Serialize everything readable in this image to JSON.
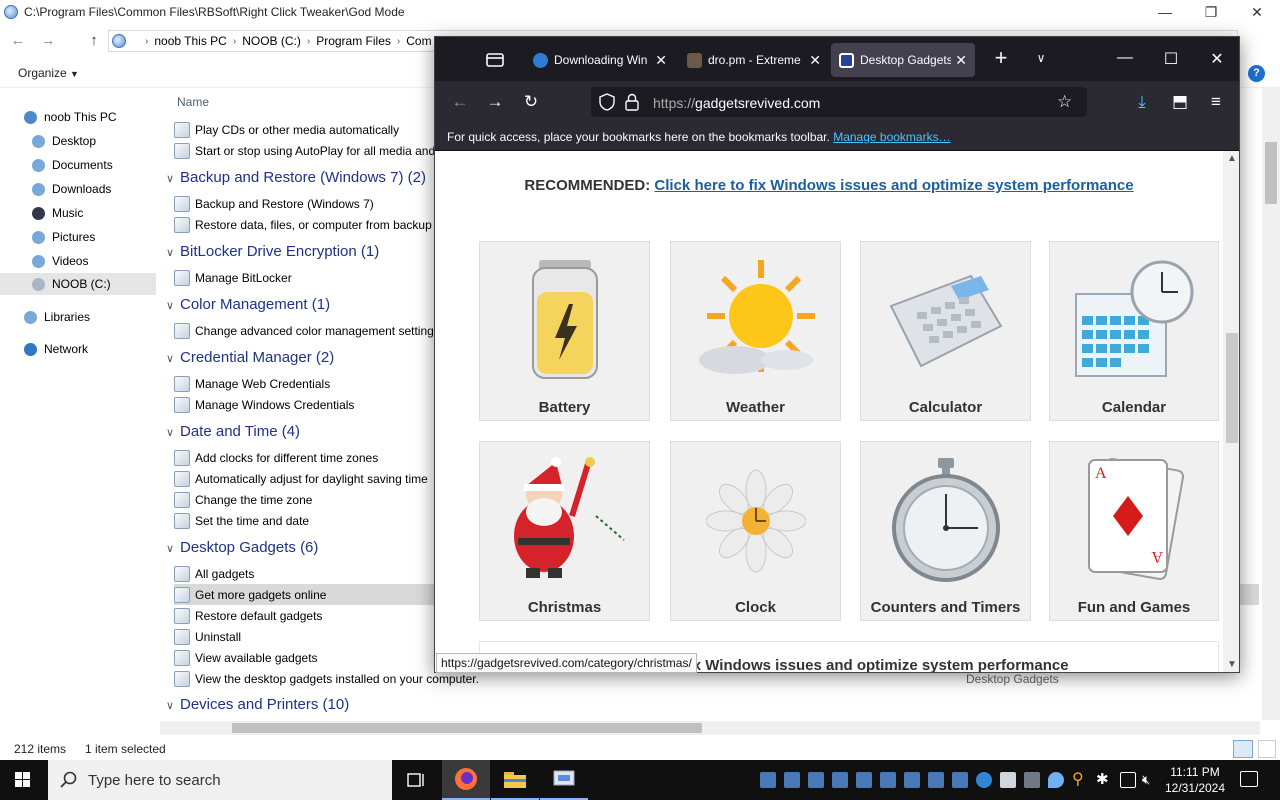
{
  "explorer": {
    "title_path": "C:\\Program Files\\Common Files\\RBSoft\\Right Click Tweaker\\God Mode",
    "breadcrumbs": [
      "noob This PC",
      "NOOB (C:)",
      "Program Files",
      "Com"
    ],
    "organize_label": "Organize",
    "help_label": "?",
    "column_name": "Name",
    "nav_items": [
      {
        "label": "noob This PC",
        "icon": "pc-icon"
      },
      {
        "label": "Desktop",
        "icon": "desktop-icon"
      },
      {
        "label": "Documents",
        "icon": "documents-icon"
      },
      {
        "label": "Downloads",
        "icon": "downloads-icon"
      },
      {
        "label": "Music",
        "icon": "music-icon"
      },
      {
        "label": "Pictures",
        "icon": "pictures-icon"
      },
      {
        "label": "Videos",
        "icon": "videos-icon"
      },
      {
        "label": "NOOB (C:)",
        "icon": "drive-icon"
      },
      {
        "label": "Libraries",
        "icon": "libraries-icon"
      },
      {
        "label": "Network",
        "icon": "network-icon"
      }
    ],
    "rows": [
      {
        "type": "item",
        "label": "Play CDs or other media automatically"
      },
      {
        "type": "item",
        "label": "Start or stop using AutoPlay for all media and"
      },
      {
        "type": "group",
        "label": "Backup and Restore (Windows 7) (2)"
      },
      {
        "type": "item",
        "label": "Backup and Restore (Windows 7)"
      },
      {
        "type": "item",
        "label": "Restore data, files, or computer from backup"
      },
      {
        "type": "group",
        "label": "BitLocker Drive Encryption (1)"
      },
      {
        "type": "item",
        "label": "Manage BitLocker"
      },
      {
        "type": "group",
        "label": "Color Management (1)"
      },
      {
        "type": "item",
        "label": "Change advanced color management setting"
      },
      {
        "type": "group",
        "label": "Credential Manager (2)"
      },
      {
        "type": "item",
        "label": "Manage Web Credentials"
      },
      {
        "type": "item",
        "label": "Manage Windows Credentials"
      },
      {
        "type": "group",
        "label": "Date and Time (4)"
      },
      {
        "type": "item",
        "label": "Add clocks for different time zones"
      },
      {
        "type": "item",
        "label": "Automatically adjust for daylight saving time"
      },
      {
        "type": "item",
        "label": "Change the time zone"
      },
      {
        "type": "item",
        "label": "Set the time and date"
      },
      {
        "type": "group",
        "label": "Desktop Gadgets (6)"
      },
      {
        "type": "item",
        "label": "All gadgets"
      },
      {
        "type": "item",
        "label": "Get more gadgets online",
        "selected": true
      },
      {
        "type": "item",
        "label": "Restore default gadgets"
      },
      {
        "type": "item",
        "label": "Uninstall"
      },
      {
        "type": "item",
        "label": "View available gadgets"
      },
      {
        "type": "item",
        "label": "View the desktop gadgets installed on your computer."
      },
      {
        "type": "group",
        "label": "Devices and Printers (10)"
      }
    ],
    "item_category_caption": "Desktop Gadgets",
    "status_count": "212 items",
    "status_selected": "1 item selected"
  },
  "firefox": {
    "tabs": [
      {
        "label": "Downloading Win",
        "active": false,
        "favicon_color": "#2f7bd6"
      },
      {
        "label": "dro.pm - Extreme",
        "active": false,
        "favicon_color": "#6b5a48"
      },
      {
        "label": "Desktop Gadgets",
        "active": true,
        "favicon_color": "#2b3fa0"
      }
    ],
    "url_protocol": "https://",
    "url_host": "gadgetsrevived.com",
    "bookmarks_hint": "For quick access, place your bookmarks here on the bookmarks toolbar.",
    "bookmarks_link": "Manage bookmarks…",
    "recommended_label": "RECOMMENDED:",
    "recommended_link": "Click here to fix Windows issues and optimize system performance",
    "recommended_link_partial": "here to fix Windows issues and optimize system performance",
    "gadgets": [
      {
        "name": "Battery",
        "icon": "battery-icon"
      },
      {
        "name": "Weather",
        "icon": "weather-icon"
      },
      {
        "name": "Calculator",
        "icon": "calculator-icon"
      },
      {
        "name": "Calendar",
        "icon": "calendar-icon"
      },
      {
        "name": "Christmas",
        "icon": "santa-icon"
      },
      {
        "name": "Clock",
        "icon": "clock-icon"
      },
      {
        "name": "Counters and Timers",
        "icon": "stopwatch-icon"
      },
      {
        "name": "Fun and Games",
        "icon": "playing-card-icon"
      }
    ],
    "status_url": "https://gadgetsrevived.com/category/christmas/"
  },
  "taskbar": {
    "search_placeholder": "Type here to search",
    "time": "11:11 PM",
    "date": "12/31/2024"
  },
  "colors": {
    "firefox_dark": "#1c1b22",
    "firefox_toolbar": "#2b2a33",
    "link_blue": "#1a5fa0",
    "group_blue": "#1e3287",
    "taskbar": "#101010"
  }
}
